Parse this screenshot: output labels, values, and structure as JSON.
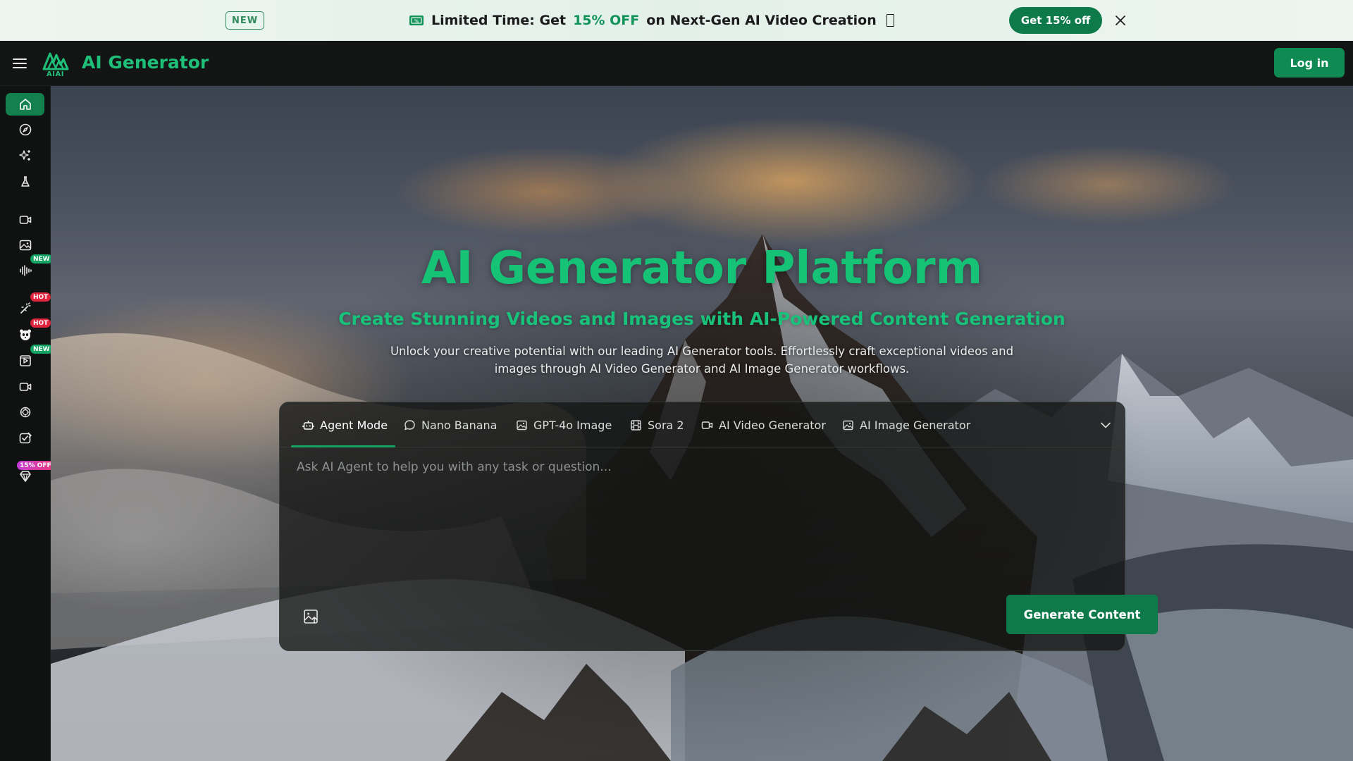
{
  "promo": {
    "badge": "NEW",
    "text_prefix": "Limited Time: Get",
    "text_highlight": "15% OFF",
    "text_suffix": "on Next-Gen AI Video Creation",
    "cta": "Get 15% off"
  },
  "header": {
    "logo_sub": "AIAI",
    "brand": "AI Generator",
    "login": "Log in"
  },
  "sidebar": {
    "items": [
      {
        "icon": "home-icon",
        "active": true,
        "badge": ""
      },
      {
        "icon": "compass-icon",
        "badge": ""
      },
      {
        "icon": "sparkles-icon",
        "badge": ""
      },
      {
        "icon": "flask-icon",
        "badge": ""
      },
      {
        "icon": "video-icon",
        "badge": ""
      },
      {
        "icon": "image-icon",
        "badge": ""
      },
      {
        "icon": "audio-wave-icon",
        "badge": "NEW"
      },
      {
        "icon": "magic-wand-icon",
        "badge": "HOT"
      },
      {
        "icon": "panda-icon",
        "badge": "HOT"
      },
      {
        "icon": "video-play-icon",
        "badge": "NEW"
      },
      {
        "icon": "camera-icon",
        "badge": ""
      },
      {
        "icon": "openai-icon",
        "badge": ""
      },
      {
        "icon": "edit-image-icon",
        "badge": ""
      },
      {
        "icon": "diamond-icon",
        "badge": "15% OFF"
      }
    ]
  },
  "hero": {
    "title": "AI Generator Platform",
    "subtitle": "Create Stunning Videos and Images with AI-Powered Content Generation",
    "description": "Unlock your creative potential with our leading AI Generator tools. Effortlessly craft exceptional videos and images through AI Video Generator and AI Image Generator workflows."
  },
  "panel": {
    "tabs": [
      {
        "label": "Agent Mode",
        "icon": "robot-icon",
        "active": true
      },
      {
        "label": "Nano Banana",
        "icon": "chat-bubble-icon"
      },
      {
        "label": "GPT-4o Image",
        "icon": "image-icon"
      },
      {
        "label": "Sora 2",
        "icon": "film-icon"
      },
      {
        "label": "AI Video Generator",
        "icon": "video-icon"
      },
      {
        "label": "AI Image Generator",
        "icon": "image-icon"
      }
    ],
    "placeholder": "Ask AI Agent to help you with any task or question...",
    "generate": "Generate Content"
  },
  "colors": {
    "accent": "#0f7a49",
    "brand_green": "#15c276",
    "badge_hot": "#e0263f",
    "badge_new": "#13a463"
  }
}
